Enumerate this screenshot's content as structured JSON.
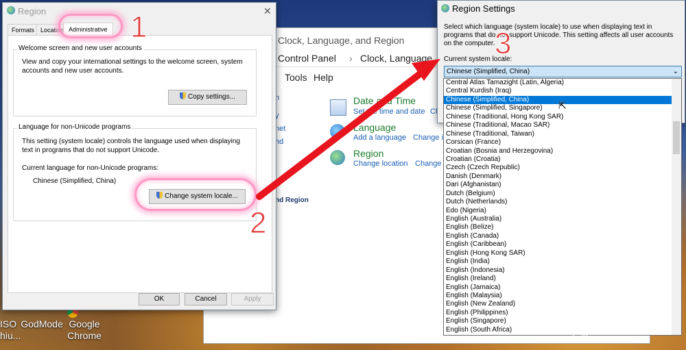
{
  "desktop": {
    "icons": [
      {
        "label": "ISO\nhiu..."
      },
      {
        "label": "GodMode"
      },
      {
        "label": "Google\nChrome"
      }
    ]
  },
  "control_panel": {
    "breadcrumb": [
      "Clock, Language, and Region",
      "Control Panel",
      "Clock, Language, an"
    ],
    "menu": [
      "Tools",
      "Help"
    ],
    "left_items": [
      "n",
      "y",
      "net",
      "nd"
    ],
    "left_footer": "nd Region",
    "categories": [
      {
        "title": "Date and Time",
        "links": [
          "Set the time and date",
          "Ch"
        ]
      },
      {
        "title": "Language",
        "links": [
          "Add a language",
          "Change in"
        ]
      },
      {
        "title": "Region",
        "links": [
          "Change location",
          "Change d"
        ]
      }
    ]
  },
  "region_dialog": {
    "title": "Region",
    "tabs": [
      "Formats",
      "Location",
      "Administrative"
    ],
    "welcome": {
      "label": "Welcome screen and new user accounts",
      "text": "View and copy your international settings to the welcome screen, system accounts and new user accounts.",
      "button": "Copy settings..."
    },
    "nonunicode": {
      "label": "Language for non-Unicode programs",
      "text": "This setting (system locale) controls the language used when displaying text in programs that do not support Unicode.",
      "current_label": "Current language for non-Unicode programs:",
      "current_value": "Chinese (Simplified, China)",
      "button": "Change system locale..."
    },
    "ok": "OK",
    "cancel": "Cancel",
    "apply": "Apply"
  },
  "region_settings": {
    "title": "Region Settings",
    "description": "Select which language (system locale) to use when displaying text in programs that do not support Unicode. This setting affects all user accounts on the computer.",
    "locale_label": "Current system locale:",
    "selected": "Chinese (Simplified, China)",
    "options": [
      "Central Atlas Tamazight (Latin, Algeria)",
      "Central Kurdish (Iraq)",
      "Chinese (Simplified, China)",
      "Chinese (Simplified, Singapore)",
      "Chinese (Traditional, Hong Kong SAR)",
      "Chinese (Traditional, Macao SAR)",
      "Chinese (Traditional, Taiwan)",
      "Corsican (France)",
      "Croatian (Bosnia and Herzegovina)",
      "Croatian (Croatia)",
      "Czech (Czech Republic)",
      "Danish (Denmark)",
      "Dari (Afghanistan)",
      "Dutch (Belgium)",
      "Dutch (Netherlands)",
      "Edo (Nigeria)",
      "English (Australia)",
      "English (Belize)",
      "English (Canada)",
      "English (Caribbean)",
      "English (Hong Kong SAR)",
      "English (India)",
      "English (Indonesia)",
      "English (Ireland)",
      "English (Jamaica)",
      "English (Malaysia)",
      "English (New Zealand)",
      "English (Philippines)",
      "English (Singapore)",
      "English (South Africa)"
    ]
  },
  "annotations": {
    "step1": "1",
    "step2": "2",
    "step3": "3"
  },
  "watermark": {
    "brand": "Bai du 经验",
    "url": "jingyan.baidu.com"
  },
  "colors": {
    "arrow": "#e8141e",
    "highlight": "#0078d7",
    "ring": "#ff8cbe"
  }
}
